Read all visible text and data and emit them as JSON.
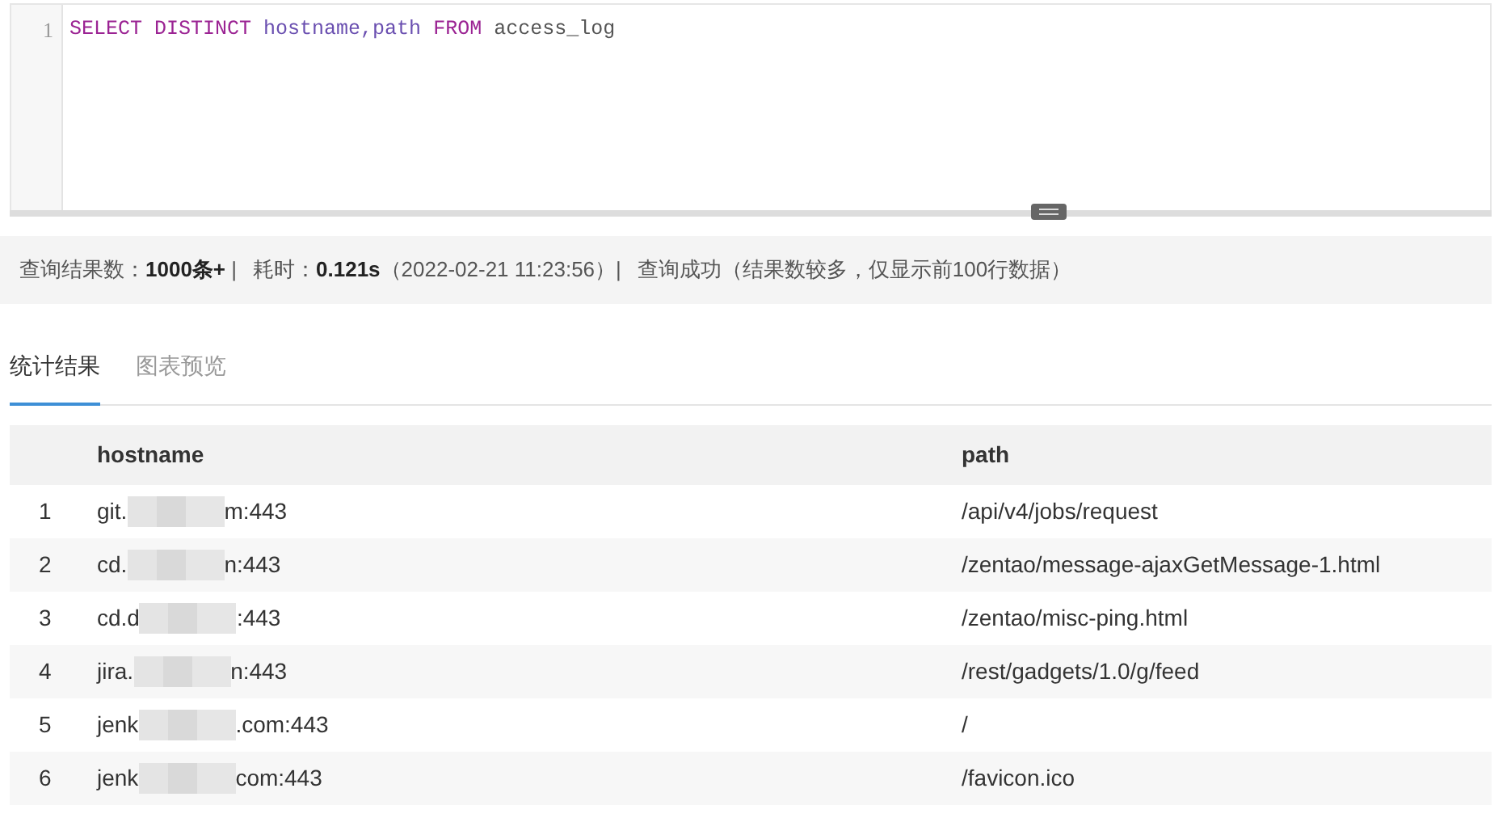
{
  "editor": {
    "line_number": "1",
    "tokens": [
      {
        "text": "SELECT DISTINCT",
        "kind": "keyword"
      },
      {
        "text": "hostname,path",
        "kind": "identifier"
      },
      {
        "text": "FROM",
        "kind": "keyword"
      },
      {
        "text": "access_log",
        "kind": "plain"
      }
    ]
  },
  "status_bar": [
    "查询结果数：**1000条+** |",
    "耗时：**0.121s**（2022-02-21 11:23:56）|",
    "查询成功（结果数较多，仅显示前100行数据）"
  ],
  "tabs": [
    {
      "label": "统计结果",
      "selected": true
    },
    {
      "label": "图表预览",
      "selected": false
    }
  ],
  "table": {
    "columns": [
      "hostname",
      "path"
    ],
    "rows": [
      {
        "index": "1",
        "hostname_prefix": "git.",
        "hostname_suffix": "m:443",
        "path": "/api/v4/jobs/request"
      },
      {
        "index": "2",
        "hostname_prefix": "cd.",
        "hostname_suffix": "n:443",
        "path": "/zentao/message-ajaxGetMessage-1.html"
      },
      {
        "index": "3",
        "hostname_prefix": "cd.d",
        "hostname_suffix": ":443",
        "path": "/zentao/misc-ping.html"
      },
      {
        "index": "4",
        "hostname_prefix": "jira.",
        "hostname_suffix": "n:443",
        "path": "/rest/gadgets/1.0/g/feed"
      },
      {
        "index": "5",
        "hostname_prefix": "jenk",
        "hostname_suffix": ".com:443",
        "path": "/"
      },
      {
        "index": "6",
        "hostname_prefix": "jenk",
        "hostname_suffix": "com:443",
        "path": "/favicon.ico"
      }
    ]
  }
}
